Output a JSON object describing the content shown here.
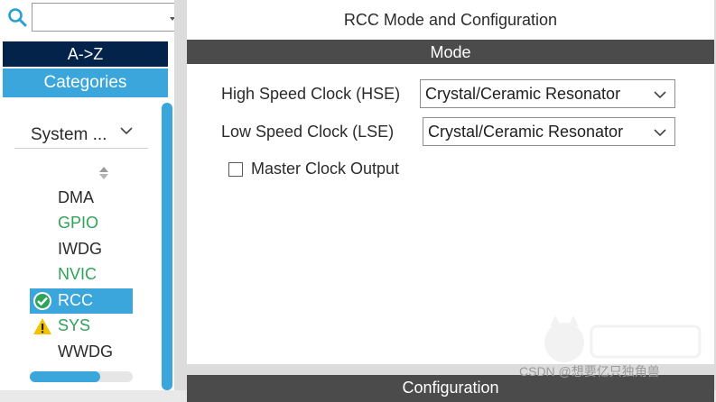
{
  "sidebar": {
    "search": {
      "value": "",
      "placeholder": ""
    },
    "az_label": "A->Z",
    "categories_label": "Categories",
    "category_select": "System ...",
    "items": [
      {
        "label": "DMA",
        "color": "#2b2b2b",
        "status": "none"
      },
      {
        "label": "GPIO",
        "color": "#2fa35a",
        "status": "none"
      },
      {
        "label": "IWDG",
        "color": "#2b2b2b",
        "status": "none"
      },
      {
        "label": "NVIC",
        "color": "#2fa35a",
        "status": "none"
      },
      {
        "label": "RCC",
        "color": "#ffffff",
        "status": "check-circle-icon",
        "selected": true
      },
      {
        "label": "SYS",
        "color": "#2fa35a",
        "status": "warning-icon"
      },
      {
        "label": "WWDG",
        "color": "#2b2b2b",
        "status": "none"
      }
    ]
  },
  "main": {
    "title": "RCC Mode and Configuration",
    "mode_header": "Mode",
    "hse": {
      "label": "High Speed Clock (HSE)",
      "value": "Crystal/Ceramic Resonator"
    },
    "lse": {
      "label": "Low Speed Clock (LSE)",
      "value": "Crystal/Ceramic Resonator"
    },
    "master_clock": {
      "label": "Master Clock Output",
      "checked": false
    },
    "config_header": "Configuration"
  },
  "watermark": {
    "text": "CSDN @想要亿只独角兽"
  },
  "colors": {
    "accent": "#3aa6dc",
    "navy": "#03234b",
    "header_bg": "#4b4b4b",
    "green_text": "#2fa35a",
    "warning": "#f2c200"
  }
}
